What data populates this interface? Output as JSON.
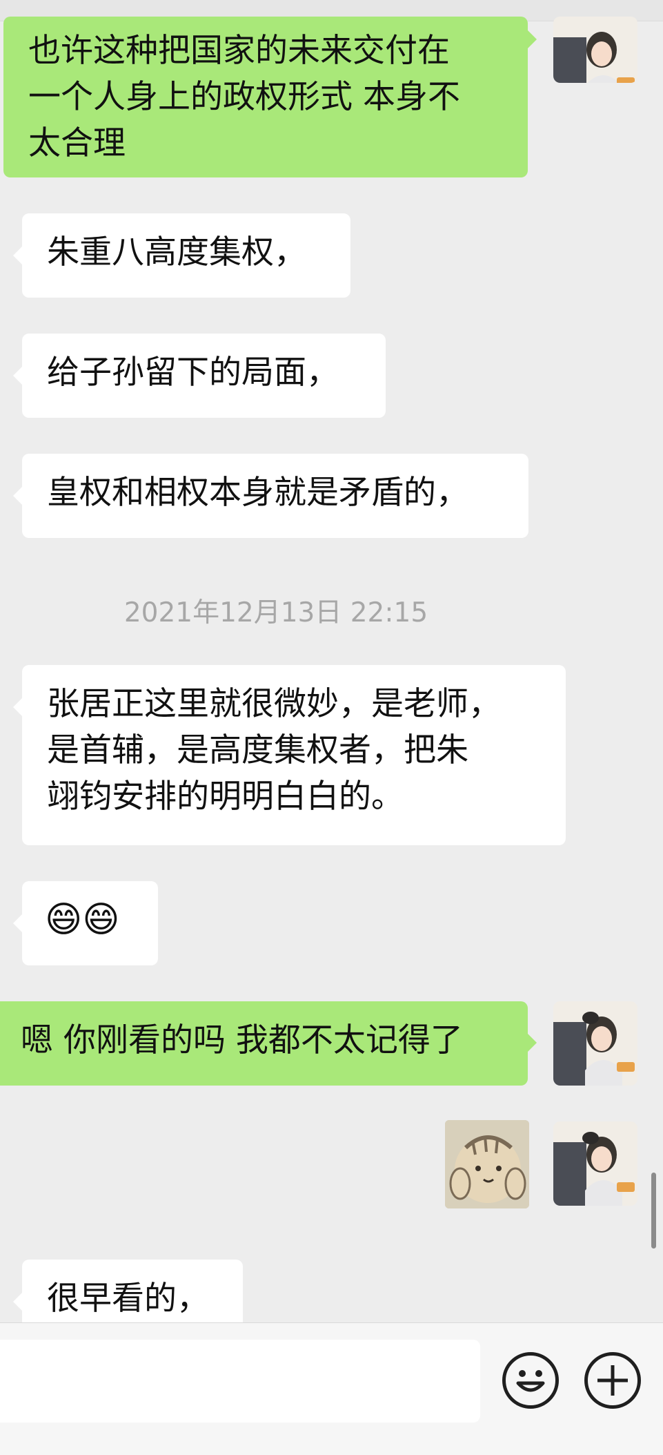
{
  "messages": [
    {
      "text": "也许这种把国家的未来交付在\n一个人身上的政权形式 本身不\n太合理"
    },
    {
      "text": "朱重八高度集权，"
    },
    {
      "text": "给子孙留下的局面，"
    },
    {
      "text": "皇权和相权本身就是矛盾的，"
    },
    {
      "text": "张居正这里就很微妙，是老师，\n是首辅，是高度集权者，把朱\n翊钧安排的明明白白的。"
    },
    {
      "text": "😄😄"
    },
    {
      "text": "嗯 你刚看的吗 我都不太记得了"
    },
    {
      "text": "很早看的，"
    }
  ],
  "timestamp": "2021年12月13日 22:15",
  "icons": {
    "emoji_button": "smiley-face-icon",
    "plus_button": "plus-circle-icon"
  },
  "colors": {
    "background": "#ededed",
    "outgoing_bubble": "#a9e879",
    "incoming_bubble": "#ffffff",
    "timestamp_text": "#a7a7a7"
  }
}
